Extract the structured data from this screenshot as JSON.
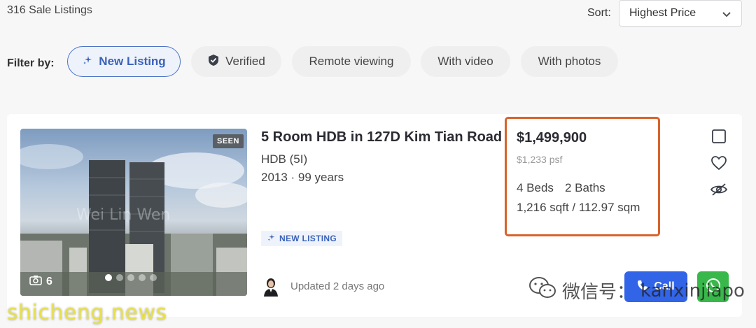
{
  "results": {
    "count_text": "316 Sale Listings"
  },
  "sort": {
    "label": "Sort:",
    "value": "Highest Price"
  },
  "filters": {
    "label": "Filter by:",
    "items": [
      {
        "label": "New Listing",
        "active": true,
        "icon": "sparkle-icon"
      },
      {
        "label": "Verified",
        "active": false,
        "icon": "shield-check-icon"
      },
      {
        "label": "Remote viewing",
        "active": false
      },
      {
        "label": "With video",
        "active": false
      },
      {
        "label": "With photos",
        "active": false
      }
    ]
  },
  "listing": {
    "seen_badge": "SEEN",
    "photo_count": "6",
    "title": "5 Room HDB in 127D Kim Tian Road",
    "property_type": "HDB (5I)",
    "built_tenure": "2013 · 99 years",
    "new_listing_badge": "NEW LISTING",
    "price": "$1,499,900",
    "psf": "$1,233 psf",
    "beds": "4 Beds",
    "baths": "2 Baths",
    "area": "1,216 sqft / 112.97 sqm",
    "updated": "Updated 2 days ago",
    "call_label": "Call"
  },
  "watermarks": {
    "wechat_cn": "微信号：",
    "wechat_id": "kanxinjiapo",
    "site": "shicheng.news",
    "photo_mark": "Wei Lin Wen"
  },
  "colors": {
    "accent_blue": "#3a62b8",
    "highlight_border": "#d8632a",
    "call_button": "#3264e8",
    "whatsapp_button": "#38b84a"
  }
}
